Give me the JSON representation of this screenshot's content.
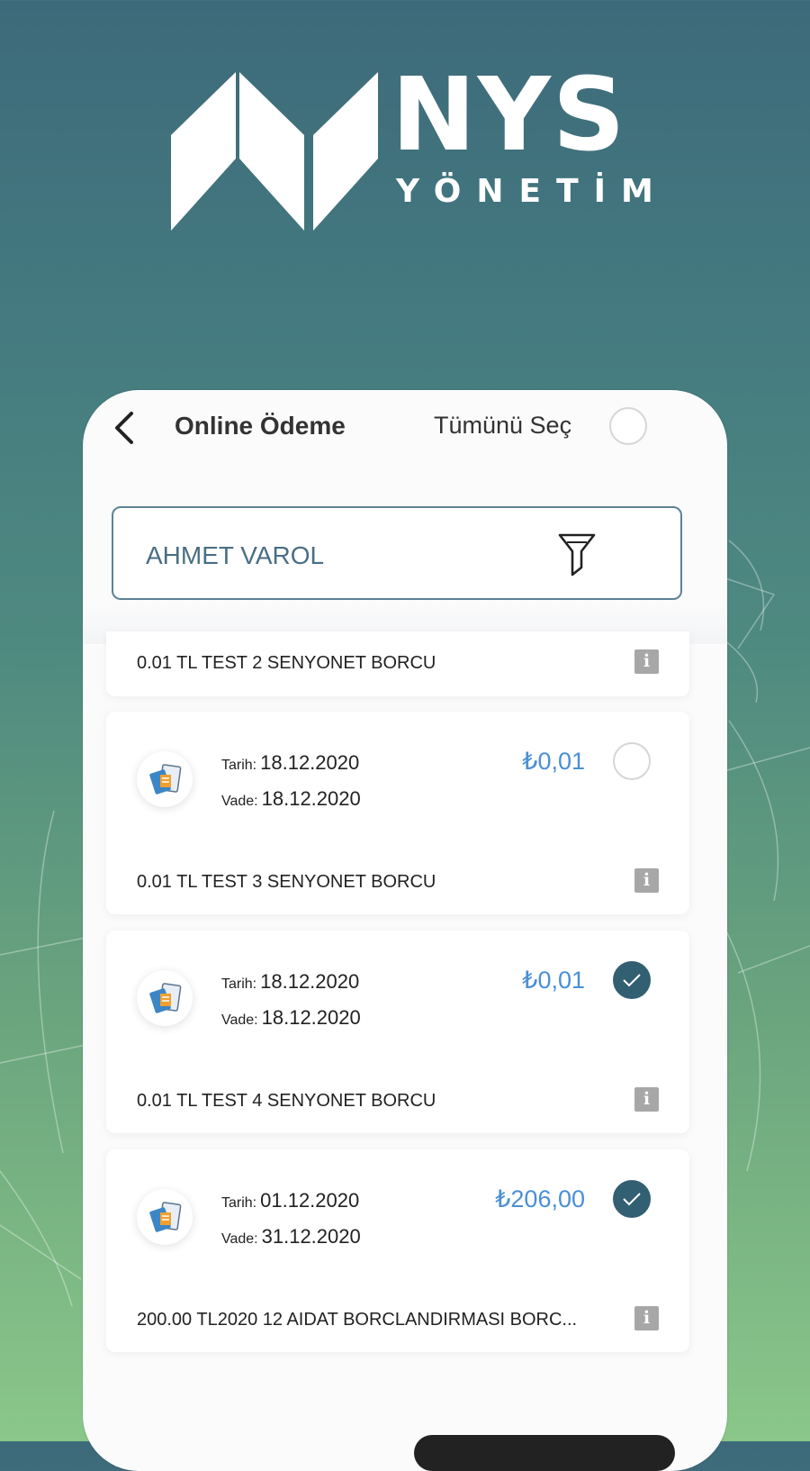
{
  "logo": {
    "title": "NYS",
    "subtitle": "YÖNETİM"
  },
  "header": {
    "back_icon": "chevron-left-icon",
    "title": "Online Ödeme",
    "select_all_label": "Tümünü Seç",
    "select_all_checked": false
  },
  "search": {
    "value": "AHMET VAROL",
    "filter_icon": "filter-icon"
  },
  "debts": [
    {
      "description": "0.01 TL TEST 2 SENYONET BORCU",
      "partial": true
    },
    {
      "date_label": "Tarih:",
      "date": "18.12.2020",
      "due_label": "Vade:",
      "due": "18.12.2020",
      "amount": "₺0,01",
      "checked": false,
      "description": "0.01 TL TEST 3 SENYONET BORCU"
    },
    {
      "date_label": "Tarih:",
      "date": "18.12.2020",
      "due_label": "Vade:",
      "due": "18.12.2020",
      "amount": "₺0,01",
      "checked": true,
      "description": "0.01 TL TEST 4 SENYONET BORCU"
    },
    {
      "date_label": "Tarih:",
      "date": "01.12.2020",
      "due_label": "Vade:",
      "due": "31.12.2020",
      "amount": "₺206,00",
      "checked": true,
      "description": "200.00 TL2020 12 AIDAT BORCLANDIRMASI BORC..."
    }
  ],
  "info_icon_label": "i",
  "colors": {
    "accent": "#335f73",
    "amount": "#4a8fd6",
    "border": "#5d8295"
  }
}
